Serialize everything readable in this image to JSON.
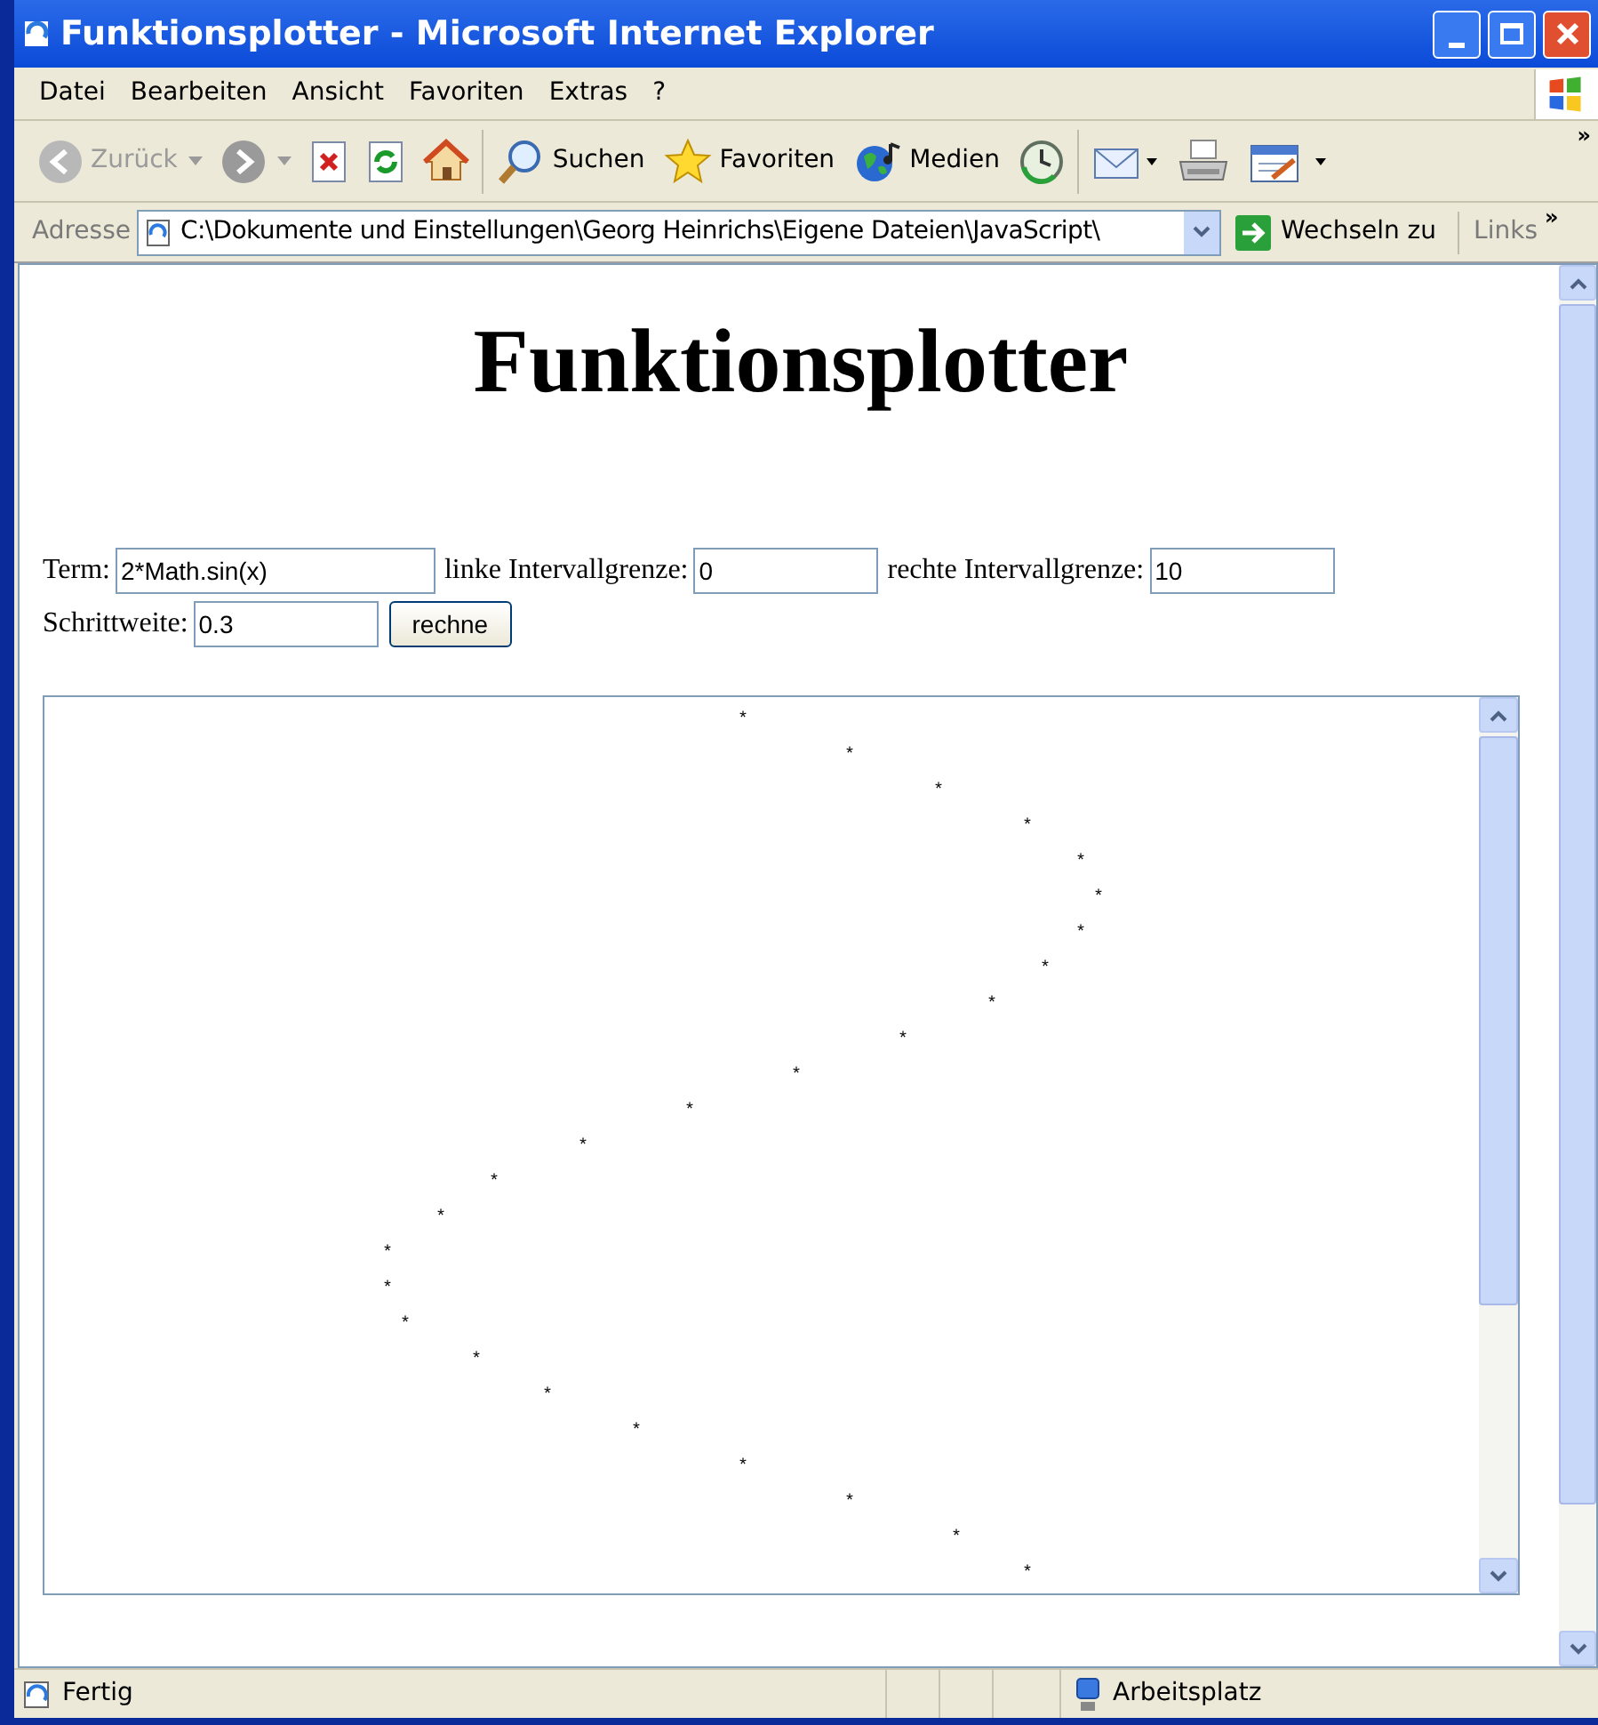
{
  "window": {
    "title": "Funktionsplotter - Microsoft Internet Explorer"
  },
  "menu": [
    {
      "label": "Datei"
    },
    {
      "label": "Bearbeiten"
    },
    {
      "label": "Ansicht"
    },
    {
      "label": "Favoriten"
    },
    {
      "label": "Extras"
    },
    {
      "label": "?"
    }
  ],
  "toolbar": [
    {
      "kind": "back",
      "label": "Zurück",
      "disabled": true
    },
    {
      "kind": "forward",
      "disabled": false
    },
    {
      "kind": "stop"
    },
    {
      "kind": "refresh"
    },
    {
      "kind": "home"
    },
    {
      "kind": "search",
      "label": "Suchen"
    },
    {
      "kind": "favorites",
      "label": "Favoriten"
    },
    {
      "kind": "media",
      "label": "Medien"
    },
    {
      "kind": "history"
    },
    {
      "kind": "mail"
    },
    {
      "kind": "print"
    },
    {
      "kind": "edit"
    }
  ],
  "toolbar_more": "»",
  "address": {
    "label": "Adresse",
    "value": "C:\\Dokumente und Einstellungen\\Georg Heinrichs\\Eigene Dateien\\JavaScript\\",
    "go": "Wechseln zu",
    "links": "Links",
    "links_more": "»"
  },
  "page": {
    "heading": "Funktionsplotter",
    "fields": [
      {
        "label": "Term:",
        "value": "2*Math.sin(x)"
      },
      {
        "label": "linke Intervallgrenze:",
        "value": "0"
      },
      {
        "label": "rechte Intervallgrenze:",
        "value": "10"
      },
      {
        "label": "Schrittweite:",
        "value": "0.3"
      }
    ],
    "button": "rechne",
    "plot_lines": [
      "                                       *",
      "                                             *",
      "                                                  *",
      "                                                       *",
      "                                                          *",
      "                                                           *",
      "                                                          *",
      "                                                        *",
      "                                                     *",
      "                                                *",
      "                                          *",
      "                                    *",
      "                              *",
      "                         *",
      "                      *",
      "                   *",
      "                   *",
      "                    *",
      "                        *",
      "                            *",
      "                                 *",
      "                                       *",
      "                                             *",
      "                                                   *",
      "                                                       *"
    ]
  },
  "status_bar": {
    "text": "Fertig",
    "zone": "Arbeitsplatz"
  }
}
